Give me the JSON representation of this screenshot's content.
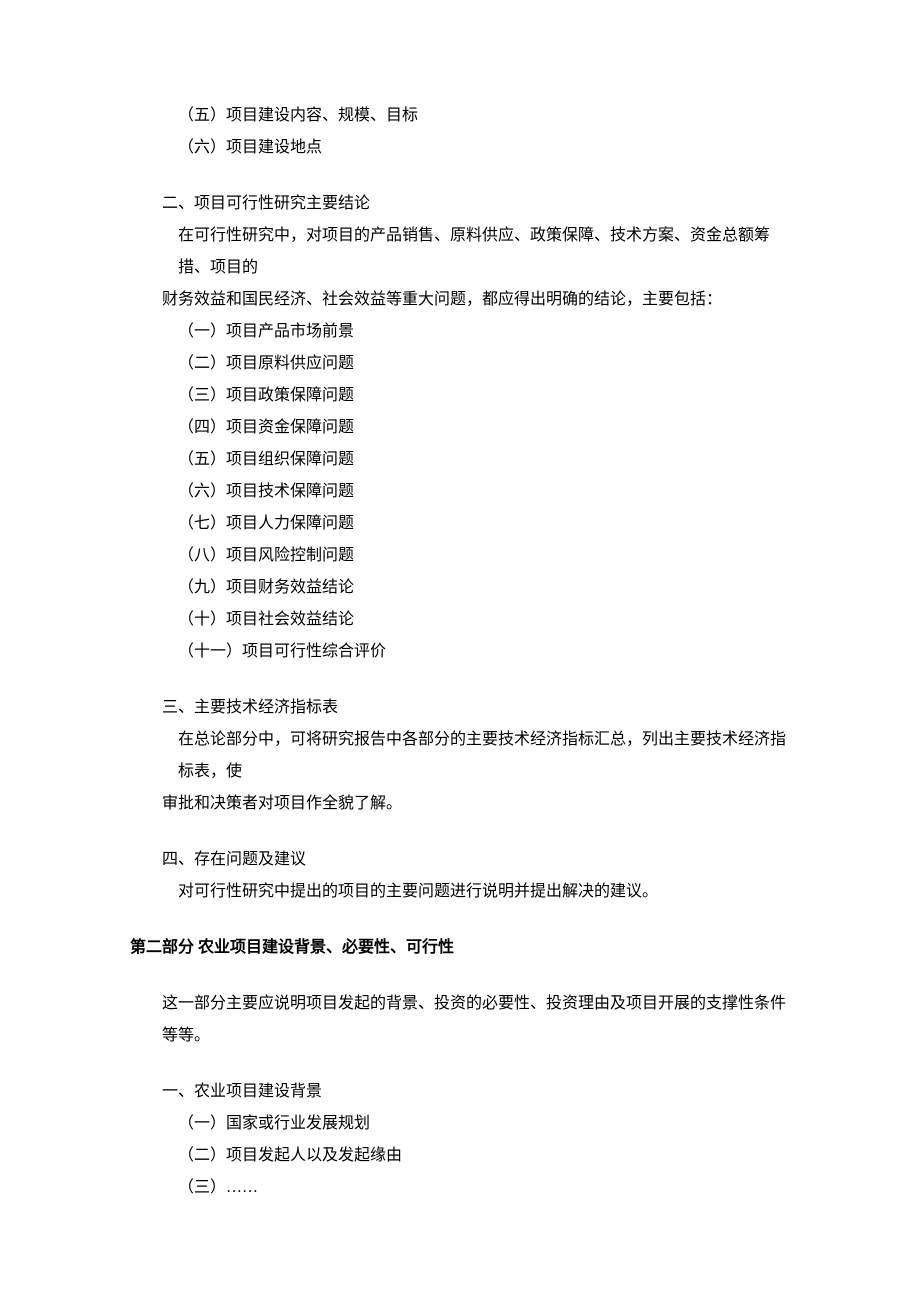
{
  "section1": {
    "listA": [
      "（五）项目建设内容、规模、目标",
      "（六）项目建设地点"
    ],
    "headingB": "二、项目可行性研究主要结论",
    "paraB1": "在可行性研究中，对项目的产品销售、原料供应、政策保障、技术方案、资金总额筹措、项目的",
    "paraB2": "财务效益和国民经济、社会效益等重大问题，都应得出明确的结论，主要包括：",
    "listB": [
      "（一）项目产品市场前景",
      "（二）项目原料供应问题",
      "（三）项目政策保障问题",
      "（四）项目资金保障问题",
      "（五）项目组织保障问题",
      "（六）项目技术保障问题",
      "（七）项目人力保障问题",
      "（八）项目风险控制问题",
      "（九）项目财务效益结论",
      "（十）项目社会效益结论",
      "（十一）项目可行性综合评价"
    ],
    "headingC": "三、主要技术经济指标表",
    "paraC1": "在总论部分中，可将研究报告中各部分的主要技术经济指标汇总，列出主要技术经济指标表，使",
    "paraC2": "审批和决策者对项目作全貌了解。",
    "headingD": "四、存在问题及建议",
    "paraD1": "对可行性研究中提出的项目的主要问题进行说明并提出解决的建议。"
  },
  "section2": {
    "title": "第二部分 农业项目建设背景、必要性、可行性",
    "intro": "这一部分主要应说明项目发起的背景、投资的必要性、投资理由及项目开展的支撑性条件等等。",
    "headingA": "一、农业项目建设背景",
    "listA": [
      "（一）国家或行业发展规划",
      "（二）项目发起人以及发起缘由",
      "（三）……"
    ]
  }
}
